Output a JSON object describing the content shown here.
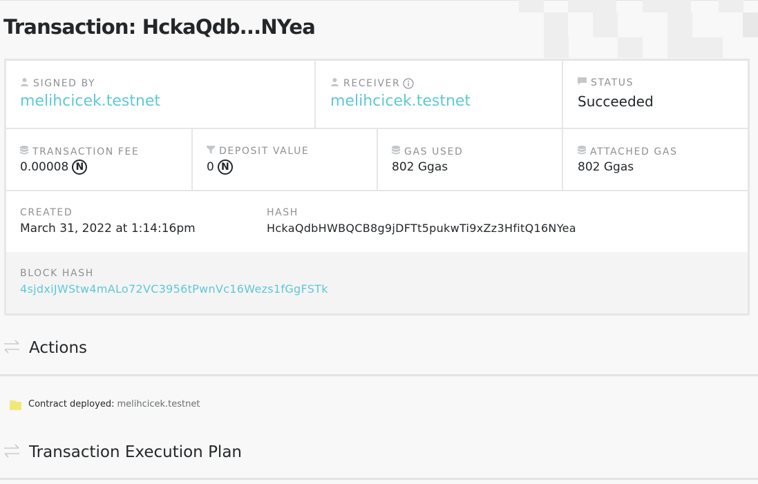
{
  "page": {
    "title": "Transaction: HckaQdb...NYea"
  },
  "summary": {
    "signed_by": {
      "label": "SIGNED BY",
      "icon": "user-icon",
      "value": "melihcicek.testnet"
    },
    "receiver": {
      "label": "RECEIVER",
      "icon": "user-icon",
      "info_icon": "info-icon",
      "value": "melihcicek.testnet"
    },
    "status": {
      "label": "STATUS",
      "icon": "comment-icon",
      "value": "Succeeded"
    },
    "transaction_fee": {
      "label": "TRANSACTION FEE",
      "icon": "coins-icon",
      "value": "0.00008",
      "unit_symbol": "N"
    },
    "deposit_value": {
      "label": "DEPOSIT VALUE",
      "icon": "filter-icon",
      "value": "0",
      "unit_symbol": "N"
    },
    "gas_used": {
      "label": "GAS USED",
      "icon": "coins-icon",
      "value": "802 Ggas"
    },
    "attached_gas": {
      "label": "ATTACHED GAS",
      "icon": "coins-icon",
      "value": "802 Ggas"
    },
    "created": {
      "label": "CREATED",
      "value": "March 31, 2022 at 1:14:16pm"
    },
    "hash": {
      "label": "HASH",
      "value": "HckaQdbHWBQCB8g9jDFTt5pukwTi9xZz3HfitQ16NYea"
    },
    "block_hash": {
      "label": "BLOCK HASH",
      "value": "4sjdxiJWStw4mALo72VC3956tPwnVc16Wezs1fGgFSTk"
    }
  },
  "actions": {
    "title": "Actions",
    "icon": "exchange-arrows-icon",
    "items": [
      {
        "icon": "folder-icon",
        "label": "Contract deployed:",
        "actor": "melihcicek.testnet"
      }
    ]
  },
  "execution_plan": {
    "title": "Transaction Execution Plan",
    "icon": "exchange-arrows-icon"
  },
  "colors": {
    "link": "#5fc7d8",
    "text": "#24272a",
    "muted_label": "#8d9093",
    "border": "#e6e6e6",
    "page_background": "#f8f8f8",
    "folder_icon": "#f0e97a"
  }
}
